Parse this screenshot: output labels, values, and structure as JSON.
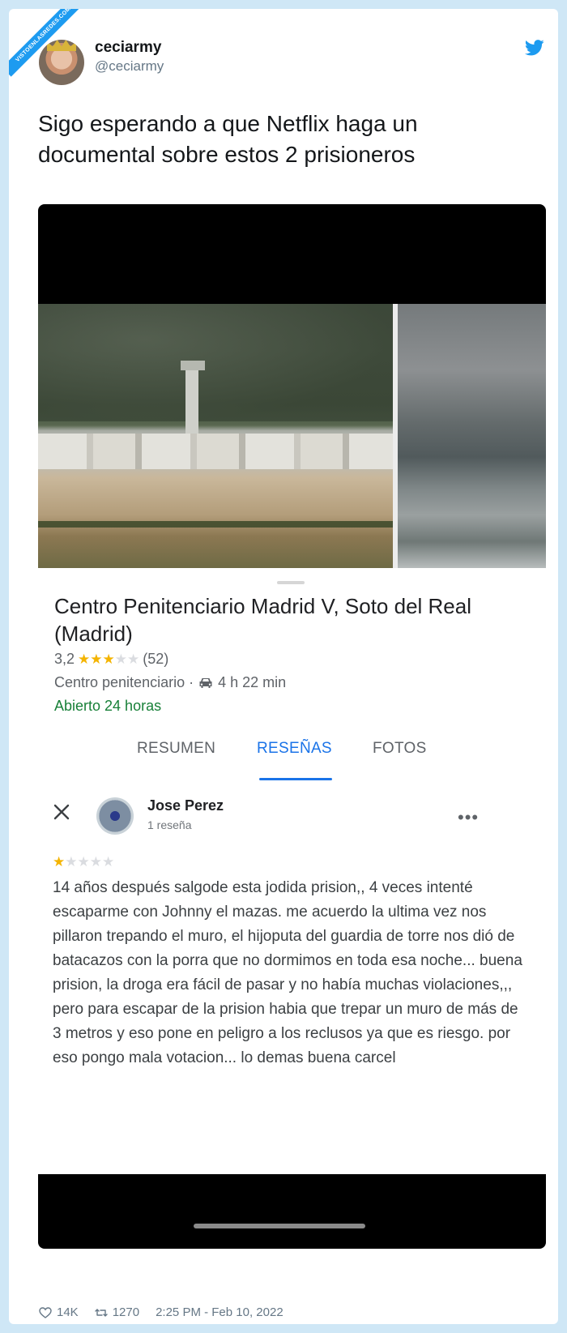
{
  "watermark": "VISTOENLASREDES.COM",
  "tweet": {
    "display_name": "ceciarmy",
    "handle": "@ceciarmy",
    "text": "Sigo esperando a que Netflix haga un documental sobre estos 2 prisioneros",
    "likes": "14K",
    "retweets": "1270",
    "timestamp": "2:25 PM - Feb 10, 2022"
  },
  "place": {
    "title": "Centro Penitenciario Madrid V, Soto del Real (Madrid)",
    "rating": "3,2",
    "rating_stars": 3,
    "review_count": "(52)",
    "category": "Centro penitenciario ·",
    "drive_time": "4 h 22 min",
    "hours": "Abierto 24 horas"
  },
  "tabs": [
    {
      "label": "RESUMEN",
      "active": false
    },
    {
      "label": "RESEÑAS",
      "active": true
    },
    {
      "label": "FOTOS",
      "active": false
    }
  ],
  "review": {
    "author": "Jose Perez",
    "author_sub": "1 reseña",
    "stars": 1,
    "text": "14 años después salgode esta jodida prision,, 4 veces intenté escaparme con Johnny el mazas. me acuerdo la ultima vez nos pillaron trepando el muro, el hijoputa del guardia de torre nos dió de batacazos con la porra que no dormimos en toda esa noche... buena prision, la droga era fácil de pasar y no había muchas violaciones,,, pero para escapar de la prision habia que trepar un muro de más de 3 metros y eso pone en peligro a los reclusos ya que es riesgo.  por eso pongo mala votacion... lo demas buena carcel"
  },
  "colors": {
    "accent_blue": "#1a73e8",
    "star_yellow": "#f4b400",
    "open_green": "#188038",
    "twitter_blue": "#1d9bf0"
  },
  "icons": [
    "twitter-bird-icon",
    "car-icon",
    "close-icon",
    "more-options-icon",
    "heart-icon",
    "retweet-icon"
  ]
}
